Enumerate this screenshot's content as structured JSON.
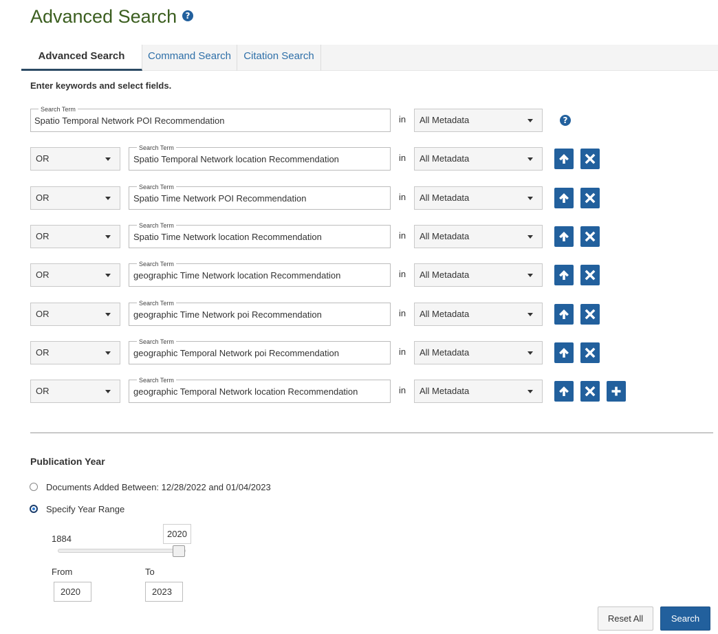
{
  "header": {
    "title": "Advanced Search"
  },
  "tabs": [
    {
      "label": "Advanced Search",
      "active": true
    },
    {
      "label": "Command Search",
      "active": false
    },
    {
      "label": "Citation Search",
      "active": false
    }
  ],
  "instructions": "Enter keywords and select fields.",
  "search_rows": [
    {
      "operator": null,
      "term_label": "Search Term",
      "term": "Spatio Temporal Network POI Recommendation",
      "in_label": "in",
      "field": "All Metadata"
    },
    {
      "operator": "OR",
      "term_label": "Search Term",
      "term": "Spatio Temporal Network location Recommendation",
      "in_label": "in",
      "field": "All Metadata"
    },
    {
      "operator": "OR",
      "term_label": "Search Term",
      "term": "Spatio Time Network POI Recommendation",
      "in_label": "in",
      "field": "All Metadata"
    },
    {
      "operator": "OR",
      "term_label": "Search Term",
      "term": "Spatio Time Network location Recommendation",
      "in_label": "in",
      "field": "All Metadata"
    },
    {
      "operator": "OR",
      "term_label": "Search Term",
      "term": "geographic Time Network location Recommendation",
      "in_label": "in",
      "field": "All Metadata"
    },
    {
      "operator": "OR",
      "term_label": "Search Term",
      "term": "geographic Time Network poi Recommendation",
      "in_label": "in",
      "field": "All Metadata"
    },
    {
      "operator": "OR",
      "term_label": "Search Term",
      "term": "geographic Temporal Network poi Recommendation",
      "in_label": "in",
      "field": "All Metadata"
    },
    {
      "operator": "OR",
      "term_label": "Search Term",
      "term": "geographic Temporal Network location Recommendation",
      "in_label": "in",
      "field": "All Metadata"
    }
  ],
  "row_icons": {
    "move_up": "arrow-up-icon",
    "remove": "close-icon",
    "add": "plus-icon",
    "help": "help-icon"
  },
  "publication_year": {
    "heading": "Publication Year",
    "option_added_between": "Documents Added Between: 12/28/2022 and 01/04/2023",
    "option_year_range": "Specify Year Range",
    "selected_option": "year_range",
    "slider": {
      "min": "1884",
      "max": 2023,
      "value_label": "2020",
      "value": 2020
    },
    "from_label": "From",
    "to_label": "To",
    "from_value": "2020",
    "to_value": "2023"
  },
  "actions": {
    "reset_label": "Reset All",
    "search_label": "Search"
  },
  "colors": {
    "accent": "#22609d",
    "title_green": "#3b5e1f"
  }
}
